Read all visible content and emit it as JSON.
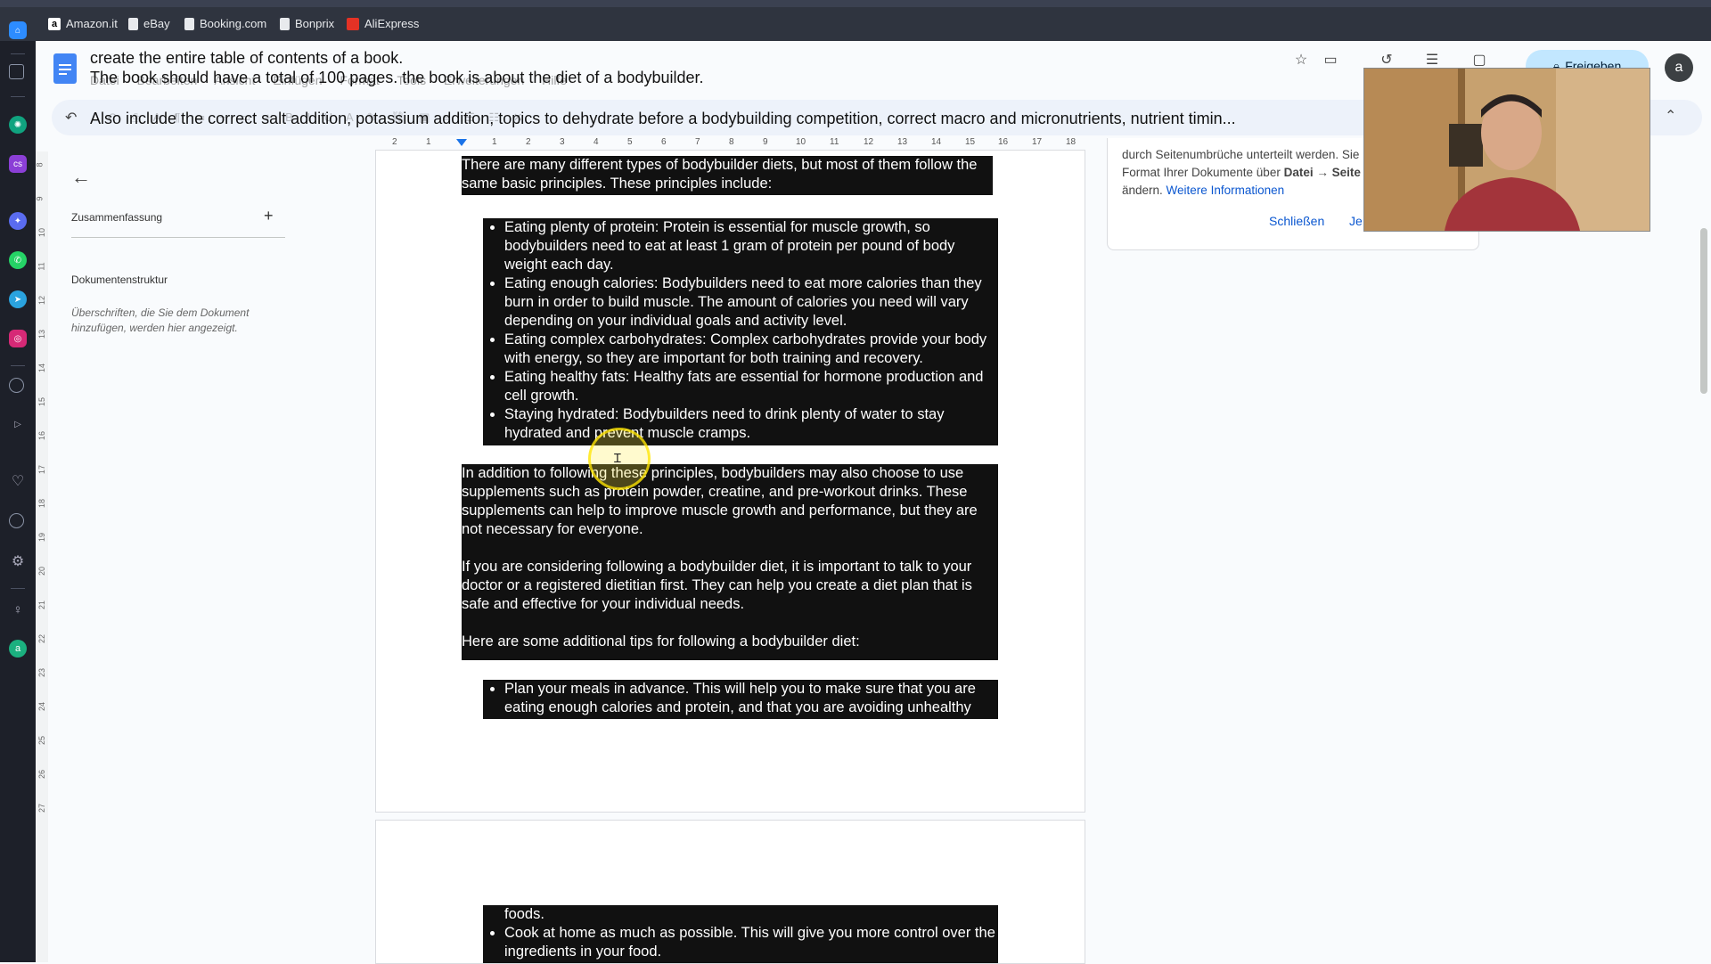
{
  "bookmarks": [
    {
      "label": "Amazon.it",
      "icon": "amazon-icon",
      "color": "#ffffff"
    },
    {
      "label": "eBay",
      "icon": "page-icon",
      "color": "#e8eaed"
    },
    {
      "label": "Booking.com",
      "icon": "page-icon",
      "color": "#e8eaed"
    },
    {
      "label": "Bonprix",
      "icon": "page-icon",
      "color": "#e8eaed"
    },
    {
      "label": "AliExpress",
      "icon": "aliexpress-icon",
      "color": "#e43225"
    }
  ],
  "prompt": {
    "line1": "create the entire table of contents of a book.",
    "line2": "The book should have a total of 100 pages. the book is about the diet of a bodybuilder.",
    "line3": "Also include the correct salt addition, potassium addition, topics to dehydrate before a bodybuilding competition, correct macro and micronutrients, nutrient timin..."
  },
  "menubar": [
    "Datei",
    "Bearbeiten",
    "Ansicht",
    "Einfügen",
    "Format",
    "Tools",
    "Erweiterungen",
    "Hilfe"
  ],
  "header": {
    "share_label": "Freigeben",
    "avatar_letter": "a"
  },
  "ruler_numbers": [
    "2",
    "1",
    "1",
    "2",
    "3",
    "4",
    "5",
    "6",
    "7",
    "8",
    "9",
    "10",
    "11",
    "12",
    "13",
    "14",
    "15",
    "16",
    "17",
    "18"
  ],
  "vruler_numbers": [
    "8",
    "9",
    "10",
    "11",
    "12",
    "13",
    "14",
    "15",
    "16",
    "17",
    "18",
    "19",
    "20",
    "21",
    "22",
    "23",
    "24",
    "25",
    "26",
    "27"
  ],
  "outline": {
    "summary_label": "Zusammenfassung",
    "structure_label": "Dokumentenstruktur",
    "structure_hint": "Überschriften, die Sie dem Dokument hinzufügen, werden hier angezeigt."
  },
  "document": {
    "intro": "There are many different types of bodybuilder diets, but most of them follow the same basic principles. These principles include:",
    "principles": [
      "Eating plenty of protein: Protein is essential for muscle growth, so bodybuilders need to eat at least 1 gram of protein per pound of body weight each day.",
      "Eating enough calories: Bodybuilders need to eat more calories than they burn in order to build muscle. The amount of calories you need will vary depending on your individual goals and activity level.",
      "Eating complex carbohydrates: Complex carbohydrates provide your body with energy, so they are important for both training and recovery.",
      "Eating healthy fats: Healthy fats are essential for hormone production and cell growth.",
      "Staying hydrated: Bodybuilders need to drink plenty of water to stay hydrated and prevent muscle cramps."
    ],
    "supplements": "In addition to following these principles, bodybuilders may also choose to use supplements such as protein powder, creatine, and pre-workout drinks. These supplements can help to improve muscle growth and performance, but they are not necessary for everyone.",
    "consult": "If you are considering following a bodybuilder diet, it is important to talk to your doctor or a registered dietitian first. They can help you create a diet plan that is safe and effective for your individual needs.",
    "tips_intro": "Here are some additional tips for following a bodybuilder diet:",
    "tip1_part1": "Plan your meals in advance. This will help you to make sure that you are eating enough calories and protein, and that you are avoiding unhealthy",
    "tip1_part2": "foods.",
    "tip2": "Cook at home as much as possible. This will give you more control over the ingredients in your food."
  },
  "comment_panel": {
    "line1": "durch Seitenumbrüche unterteilt werden. Sie",
    "line2_prefix": "Format Ihrer Dokumente über ",
    "line2_bold": "Datei → Seite",
    "line3_prefix": "ändern. ",
    "line3_link": "Weitere Informationen",
    "close_label": "Schließen",
    "more_label": "Je"
  },
  "colors": {
    "highlight": "#111111",
    "accent": "#1a73e8",
    "share_bg": "#c2e7ff"
  }
}
